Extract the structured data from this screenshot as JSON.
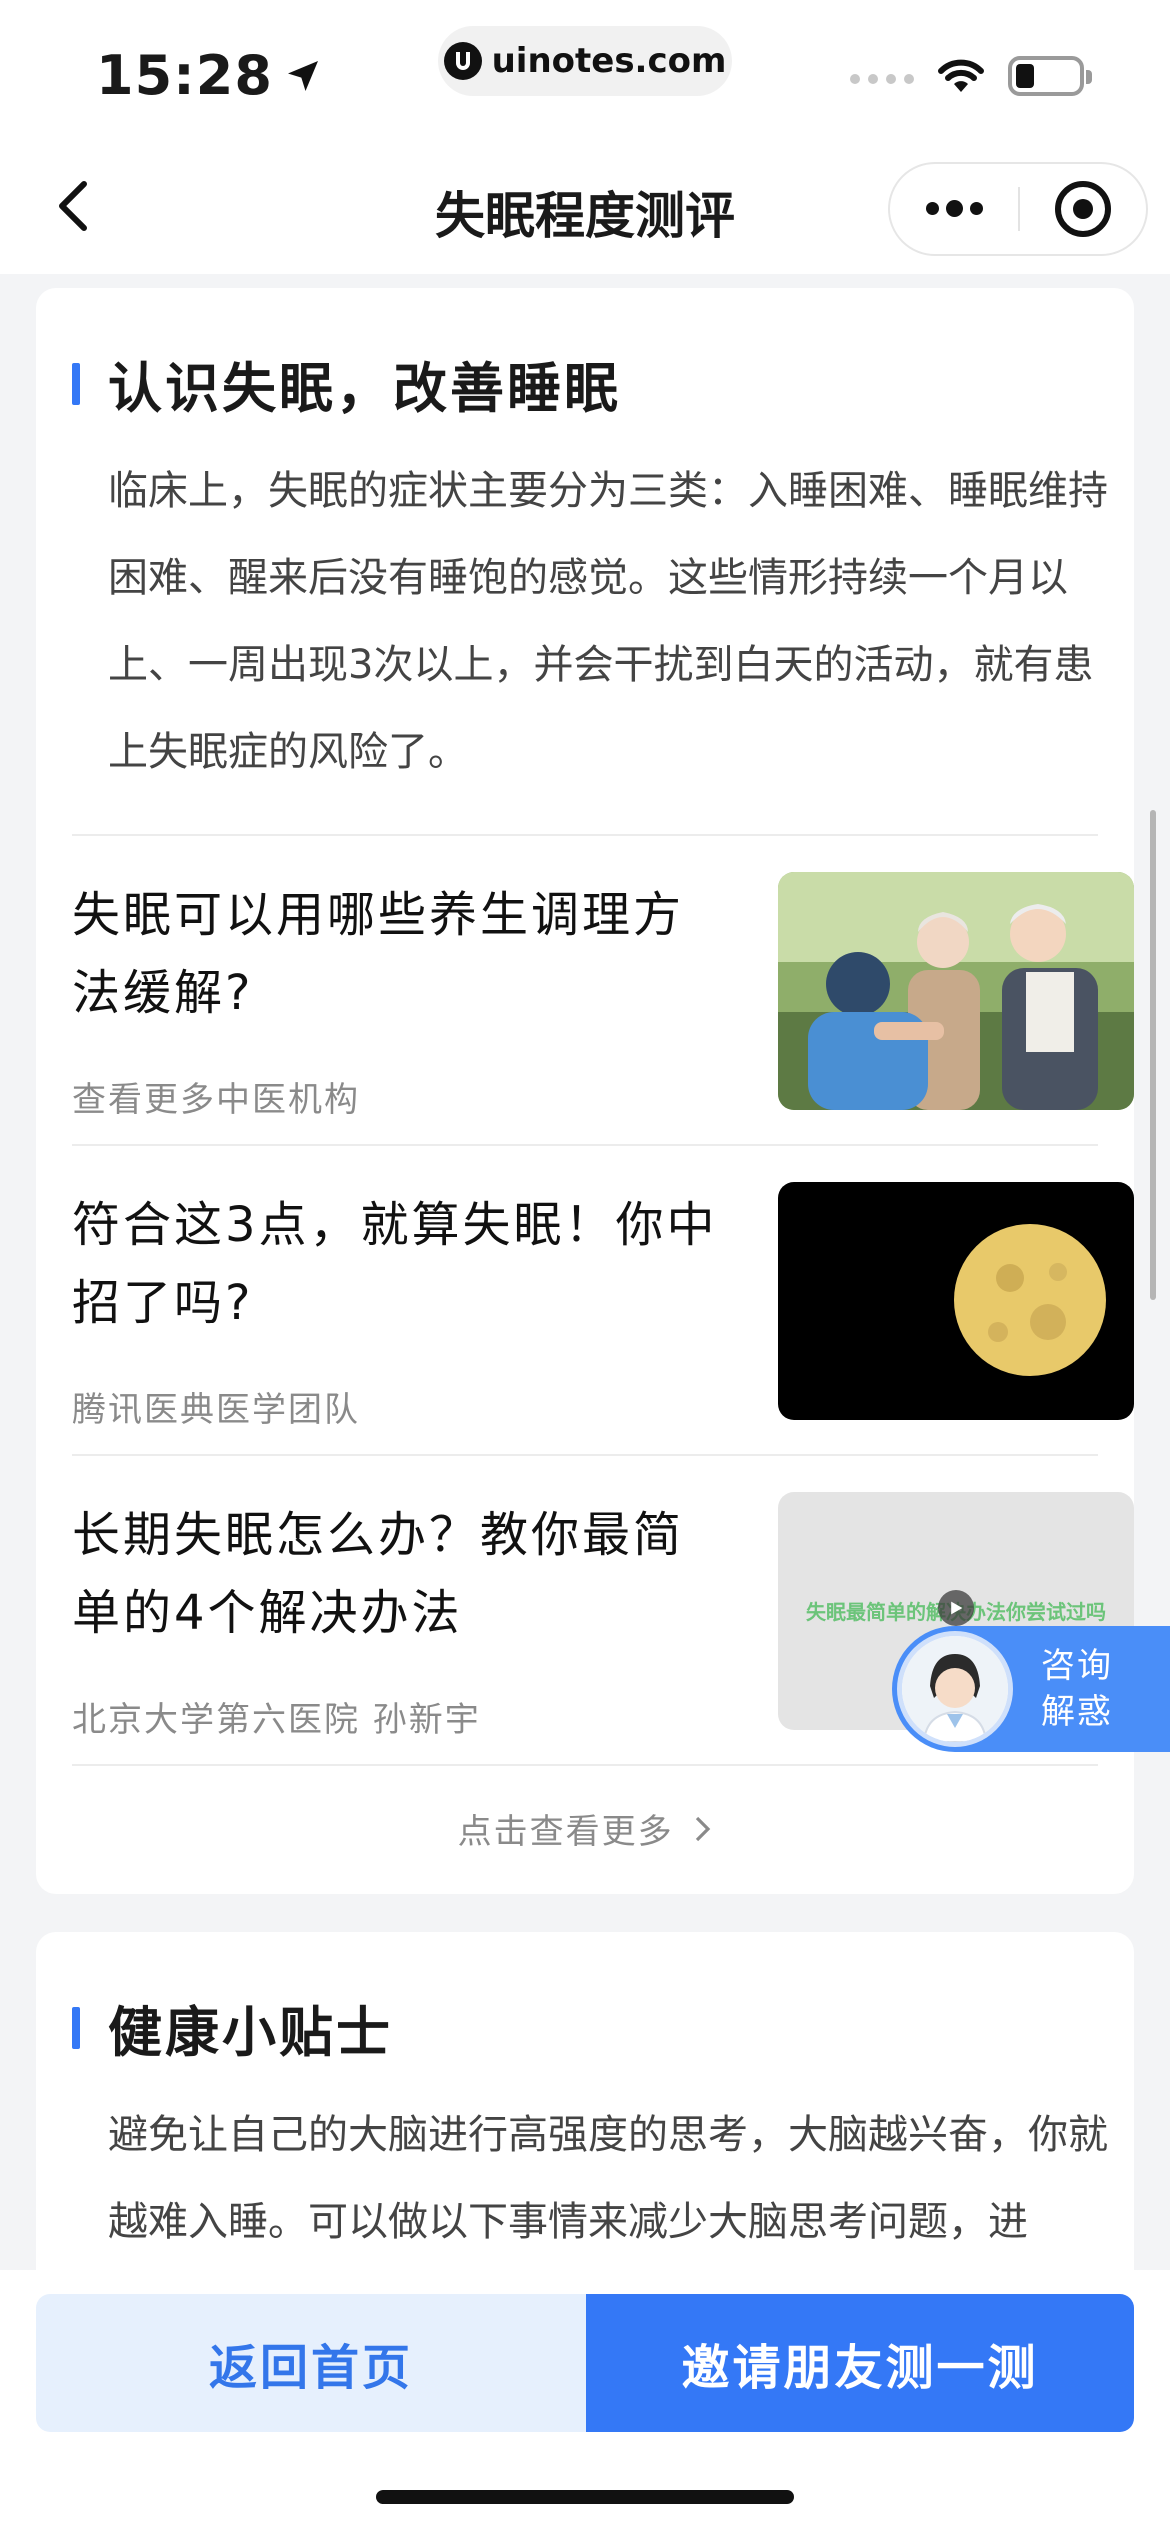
{
  "status_bar": {
    "time": "15:28",
    "url": "uinotes.com"
  },
  "nav": {
    "title": "失眠程度测评"
  },
  "section1": {
    "title": "认识失眠，改善睡眠",
    "intro": "临床上，失眠的症状主要分为三类：入睡困难、睡眠维持困难、醒来后没有睡饱的感觉。这些情形持续一个月以上、一周出现3次以上，并会干扰到白天的活动，就有患上失眠症的风险了。",
    "articles": [
      {
        "title": "失眠可以用哪些养生调理方法缓解?",
        "source": "查看更多中医机构",
        "thumb": "elderly-couple-photo"
      },
      {
        "title": "符合这3点，就算失眠！你中招了吗?",
        "source": "腾讯医典医学团队",
        "thumb": "full-moon-photo"
      },
      {
        "title": "长期失眠怎么办？教你最简单的4个解决办法",
        "source": "北京大学第六医院 孙新宇",
        "thumb": "video-thumbnail",
        "thumb_text": "失眠最简单的解决办法你尝试过吗"
      }
    ],
    "see_more": "点击查看更多"
  },
  "section2": {
    "title": "健康小贴士",
    "intro": "避免让自己的大脑进行高强度的思考，大脑越兴奋，你就越难入睡。可以做以下事情来减少大脑思考问题，进"
  },
  "consult": {
    "line1": "咨询",
    "line2": "解惑"
  },
  "bottom": {
    "home_label": "返回首页",
    "invite_label": "邀请朋友测一测"
  },
  "colors": {
    "accent": "#3478f6",
    "background": "#f3f4f6"
  }
}
